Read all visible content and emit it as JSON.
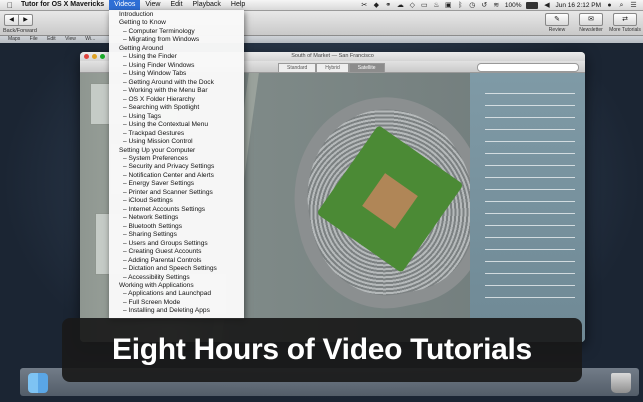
{
  "menubar": {
    "app_name": "Tutor for OS X Mavericks",
    "menus": [
      "Videos",
      "View",
      "Edit",
      "Playback",
      "Help"
    ],
    "active_menu": "Videos",
    "battery": "100%",
    "battery_level": 1.0,
    "clock": "Jun 16  2:12 PM"
  },
  "toolbar": {
    "nav_label": "Back/Forward",
    "back": "◀",
    "forward": "▶",
    "buttons": [
      {
        "label": "Review",
        "icon": "✎"
      },
      {
        "label": "Newsletter",
        "icon": "✉"
      },
      {
        "label": "More Tutorials",
        "icon": "⇄"
      }
    ]
  },
  "video": {
    "inner_menus": [
      "Maps",
      "File",
      "Edit",
      "View",
      "Wi..."
    ],
    "maps_title": "South of Market — San Francisco",
    "map_modes": [
      "Standard",
      "Hybrid",
      "Satellite"
    ],
    "selected_mode": "Satellite"
  },
  "videos_menu": [
    {
      "label": "Introduction",
      "sub": false
    },
    {
      "label": "Getting to Know",
      "sub": false
    },
    {
      "label": "– Computer Terminology",
      "sub": true
    },
    {
      "label": "– Migrating from Windows",
      "sub": true
    },
    {
      "label": "Getting Around",
      "sub": false
    },
    {
      "label": "– Using the Finder",
      "sub": true
    },
    {
      "label": "– Using Finder Windows",
      "sub": true
    },
    {
      "label": "– Using Window Tabs",
      "sub": true
    },
    {
      "label": "– Getting Around with the Dock",
      "sub": true
    },
    {
      "label": "– Working with the Menu Bar",
      "sub": true
    },
    {
      "label": "– OS X Folder Hierarchy",
      "sub": true
    },
    {
      "label": "– Searching with Spotlight",
      "sub": true
    },
    {
      "label": "– Using Tags",
      "sub": true
    },
    {
      "label": "– Using the Contextual Menu",
      "sub": true
    },
    {
      "label": "– Trackpad Gestures",
      "sub": true
    },
    {
      "label": "– Using Mission Control",
      "sub": true
    },
    {
      "label": "Setting Up your Computer",
      "sub": false
    },
    {
      "label": "– System Preferences",
      "sub": true
    },
    {
      "label": "– Security and Privacy Settings",
      "sub": true
    },
    {
      "label": "– Notification Center and Alerts",
      "sub": true
    },
    {
      "label": "– Energy Saver Settings",
      "sub": true
    },
    {
      "label": "– Printer and Scanner Settings",
      "sub": true
    },
    {
      "label": "– iCloud Settings",
      "sub": true
    },
    {
      "label": "– Internet Accounts Settings",
      "sub": true
    },
    {
      "label": "– Network Settings",
      "sub": true
    },
    {
      "label": "– Bluetooth Settings",
      "sub": true
    },
    {
      "label": "– Sharing Settings",
      "sub": true
    },
    {
      "label": "– Users and Groups Settings",
      "sub": true
    },
    {
      "label": "– Creating Guest Accounts",
      "sub": true
    },
    {
      "label": "– Adding Parental Controls",
      "sub": true
    },
    {
      "label": "– Dictation and Speech Settings",
      "sub": true
    },
    {
      "label": "– Accessibility Settings",
      "sub": true
    },
    {
      "label": "Working with Applications",
      "sub": false
    },
    {
      "label": "– Applications and Launchpad",
      "sub": true
    },
    {
      "label": "– Full Screen Mode",
      "sub": true
    },
    {
      "label": "– Installing and Deleting Apps",
      "sub": true
    }
  ],
  "caption": "Eight Hours of Video Tutorials",
  "colors": {
    "highlight": "#2f6fd6",
    "caption_bg": "#191919"
  }
}
